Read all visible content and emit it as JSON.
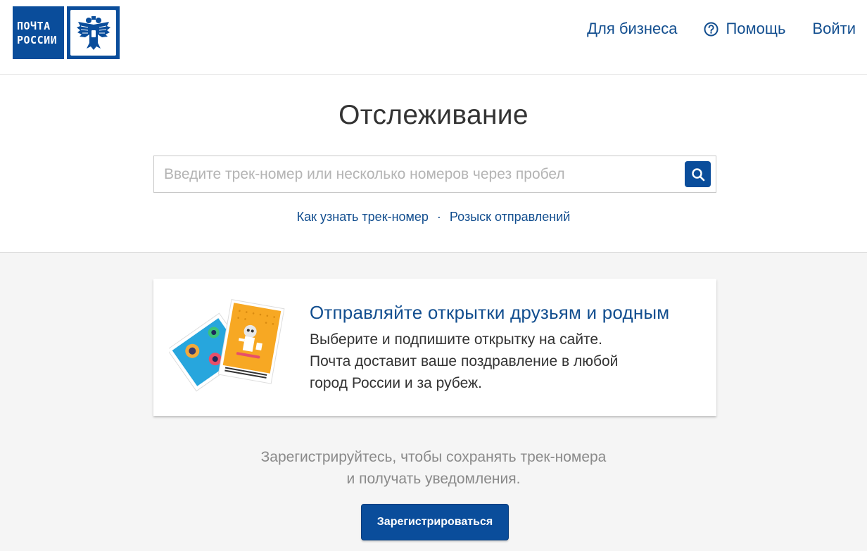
{
  "header": {
    "logo_line1": "ПОЧТА",
    "logo_line2": "РОССИИ",
    "nav_business": "Для бизнеса",
    "nav_help": "Помощь",
    "nav_login": "Войти"
  },
  "tracking": {
    "title": "Отслеживание",
    "search_placeholder": "Введите трек-номер или несколько номеров через пробел",
    "search_value": "",
    "link_how": "Как узнать трек-номер",
    "separator": "·",
    "link_search": "Розыск отправлений"
  },
  "promo": {
    "title": "Отправляйте открытки друзьям и родным",
    "line1": "Выберите и подпишите открытку на сайте.",
    "line2": "Почта доставит ваше поздравление в любой",
    "line3": "город России и за рубеж."
  },
  "register": {
    "line1": "Зарегистрируйтесь, чтобы сохранять трек-номера",
    "line2": "и получать уведомления.",
    "button_label": "Зарегистрироваться"
  },
  "icons": {
    "search": "search-icon",
    "help": "help-circle-icon",
    "logo_emblem": "double-headed-eagle-icon"
  },
  "colors": {
    "brand_blue": "#0a4d9b",
    "link_blue": "#124e8f",
    "page_bg": "#f5f5f5"
  }
}
